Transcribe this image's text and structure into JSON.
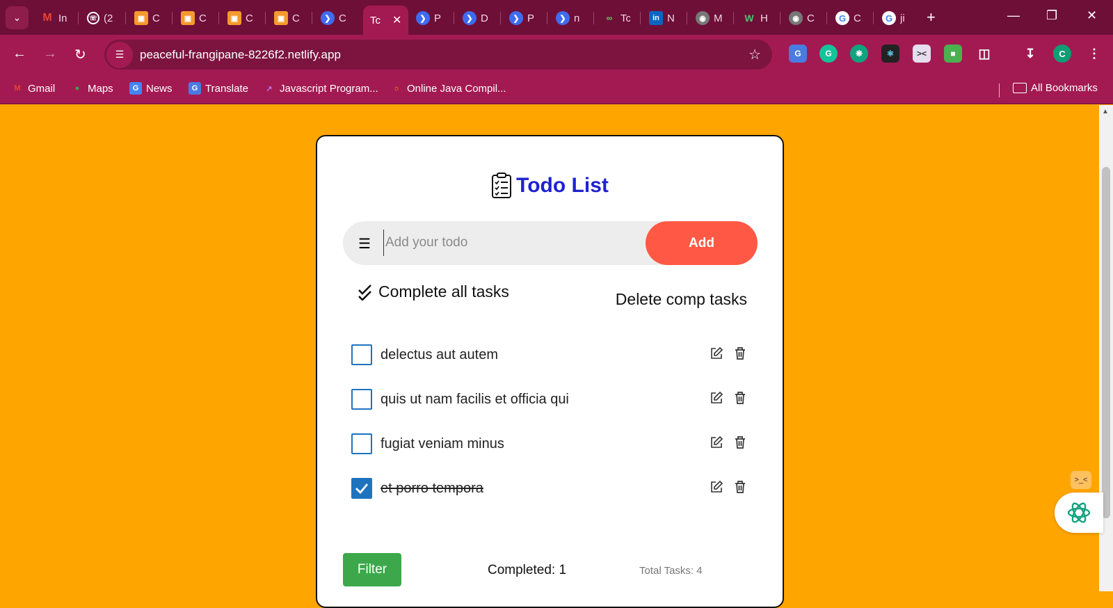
{
  "browser": {
    "active_tab_title": "Tc",
    "tabs": [
      {
        "icon": "gmail-icon",
        "title": "In"
      },
      {
        "icon": "whatsapp-icon",
        "title": "(2"
      },
      {
        "icon": "codepen-icon",
        "title": "C"
      },
      {
        "icon": "codepen-icon",
        "title": "C"
      },
      {
        "icon": "codepen-icon",
        "title": "C"
      },
      {
        "icon": "codepen-icon",
        "title": "C"
      },
      {
        "icon": "netlify-icon",
        "title": "C"
      },
      {
        "icon": "netlify-icon",
        "title": "Tc",
        "active": true
      },
      {
        "icon": "netlify-icon",
        "title": "P"
      },
      {
        "icon": "netlify-icon",
        "title": "D"
      },
      {
        "icon": "netlify-icon",
        "title": "P"
      },
      {
        "icon": "netlify-icon",
        "title": "n"
      },
      {
        "icon": "glasses-icon",
        "title": "Tc"
      },
      {
        "icon": "linkedin-icon",
        "title": "N"
      },
      {
        "icon": "globe-icon",
        "title": "M"
      },
      {
        "icon": "w-icon",
        "title": "H"
      },
      {
        "icon": "globe-icon",
        "title": "C"
      },
      {
        "icon": "google-icon",
        "title": "C"
      },
      {
        "icon": "google-icon",
        "title": "ji"
      }
    ],
    "url": "peaceful-frangipane-8226f2.netlify.app",
    "bookmarks": [
      {
        "label": "Gmail",
        "icon": "gmail-icon"
      },
      {
        "label": "Maps",
        "icon": "maps-icon"
      },
      {
        "label": "News",
        "icon": "news-icon"
      },
      {
        "label": "Translate",
        "icon": "translate-icon"
      },
      {
        "label": "Javascript Program...",
        "icon": "js-icon"
      },
      {
        "label": "Online Java Compil...",
        "icon": "sun-icon"
      }
    ],
    "all_bookmarks": "All Bookmarks",
    "profile_initial": "C"
  },
  "app": {
    "title": "Todo List",
    "input_placeholder": "Add your todo",
    "input_value": "",
    "add_label": "Add",
    "complete_all_label": "Complete all tasks",
    "delete_completed_label": "Delete comp tasks",
    "todos": [
      {
        "text": "delectus aut autem",
        "completed": false
      },
      {
        "text": "quis ut nam facilis et officia qui",
        "completed": false
      },
      {
        "text": "fugiat veniam minus",
        "completed": false
      },
      {
        "text": "et porro tempora",
        "completed": true
      }
    ],
    "filter_label": "Filter",
    "completed_label": "Completed: 1",
    "total_label": "Total Tasks: 4"
  },
  "colors": {
    "page_bg": "#FFA500",
    "title": "#1F22D1",
    "add_button": "#FF5945",
    "filter_button": "#3CA84B",
    "checkbox": "#1E73BE",
    "browser_frame": "#A31A52"
  }
}
